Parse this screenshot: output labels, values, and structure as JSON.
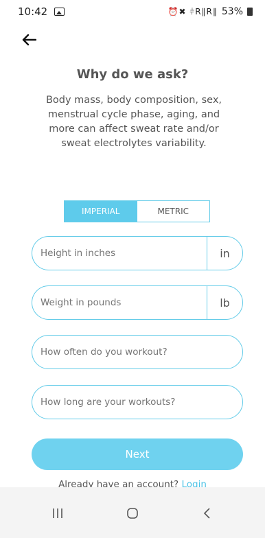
{
  "status_bar": {
    "time": "10:42",
    "icons": "⏰✖ ⫩R∥R∥",
    "battery": "53%"
  },
  "header": {
    "title": "Why do we ask?",
    "description": "Body mass, body composition, sex, menstrual cycle phase, aging, and more can affect sweat rate and/or sweat electrolytes variability."
  },
  "unit_toggle": {
    "imperial": "IMPERIAL",
    "metric": "METRIC",
    "selected": "IMPERIAL"
  },
  "fields": {
    "height": {
      "placeholder": "Height in inches",
      "unit": "in"
    },
    "weight": {
      "placeholder": "Weight in pounds",
      "unit": "lb"
    },
    "often": {
      "placeholder": "How often do you workout?"
    },
    "long": {
      "placeholder": "How long are your workouts?"
    }
  },
  "actions": {
    "next": "Next",
    "account_prompt": "Already have an account?",
    "login": "Login"
  },
  "colors": {
    "accent": "#5ecbeb",
    "text": "#555555"
  }
}
